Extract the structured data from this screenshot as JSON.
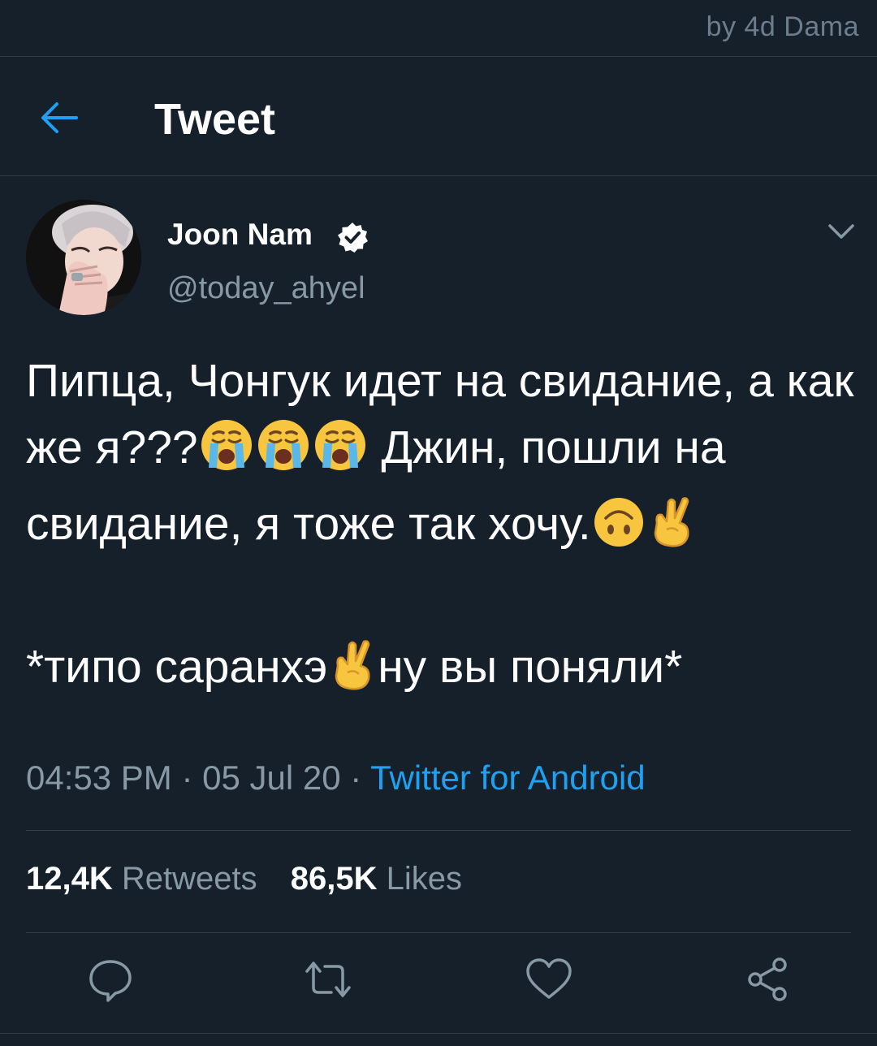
{
  "watermark": "by 4d Dama",
  "header": {
    "title": "Tweet",
    "back_icon": "arrow-left-icon"
  },
  "author": {
    "name": "Joon Nam",
    "handle": "@today_ahyel",
    "verified_icon": "verified-badge-icon",
    "menu_icon": "chevron-down-icon"
  },
  "tweet": {
    "line1_part1": "Пипца, Чонгук идет на свидание, а как же я???",
    "line1_part2": " Джин, пошли на свидание, я тоже так хочу.",
    "line2_part1": "*типо саранхэ",
    "line2_part2": "ну вы поняли*",
    "emojis": [
      "loudly-crying-face",
      "loudly-crying-face",
      "loudly-crying-face",
      "upside-down-face",
      "crossed-fingers",
      "crossed-fingers"
    ]
  },
  "meta": {
    "time": "04:53 PM",
    "sep": " · ",
    "date": "05 Jul 20",
    "source": "Twitter for Android"
  },
  "stats": {
    "retweets_count": "12,4K",
    "retweets_label": "Retweets",
    "likes_count": "86,5K",
    "likes_label": "Likes"
  },
  "colors": {
    "background": "#15202b",
    "accent": "#1da1f2",
    "secondary_text": "#8899a6",
    "divider": "#2f3d4b"
  }
}
